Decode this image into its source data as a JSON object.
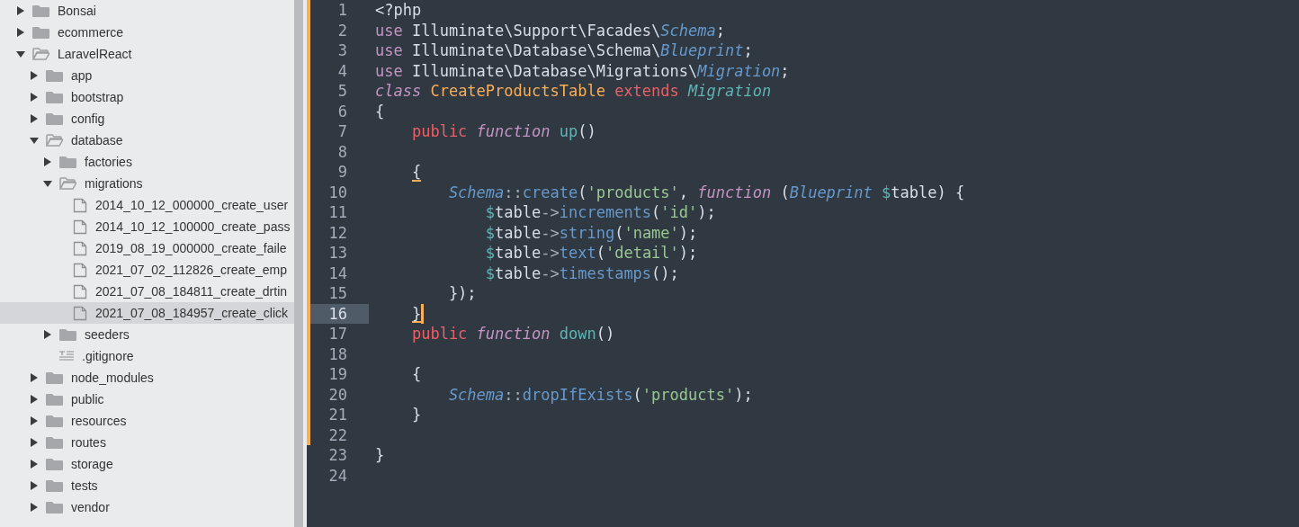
{
  "sidebar": {
    "items": [
      {
        "name": "Bonsai",
        "kind": "folder",
        "expanded": false,
        "selected": false
      },
      {
        "name": "ecommerce",
        "kind": "folder",
        "expanded": false,
        "selected": false
      },
      {
        "name": "LaravelReact",
        "kind": "folder",
        "expanded": true,
        "selected": false,
        "children": [
          {
            "name": "app",
            "kind": "folder",
            "expanded": false,
            "selected": false
          },
          {
            "name": "bootstrap",
            "kind": "folder",
            "expanded": false,
            "selected": false
          },
          {
            "name": "config",
            "kind": "folder",
            "expanded": false,
            "selected": false
          },
          {
            "name": "database",
            "kind": "folder",
            "expanded": true,
            "selected": false,
            "children": [
              {
                "name": "factories",
                "kind": "folder",
                "expanded": false,
                "selected": false
              },
              {
                "name": "migrations",
                "kind": "folder",
                "expanded": true,
                "selected": false,
                "children": [
                  {
                    "name": "2014_10_12_000000_create_user",
                    "kind": "file",
                    "selected": false
                  },
                  {
                    "name": "2014_10_12_100000_create_pass",
                    "kind": "file",
                    "selected": false
                  },
                  {
                    "name": "2019_08_19_000000_create_faile",
                    "kind": "file",
                    "selected": false
                  },
                  {
                    "name": "2021_07_02_112826_create_emp",
                    "kind": "file",
                    "selected": false
                  },
                  {
                    "name": "2021_07_08_184811_create_drtin",
                    "kind": "file",
                    "selected": false
                  },
                  {
                    "name": "2021_07_08_184957_create_click",
                    "kind": "file",
                    "selected": true
                  }
                ]
              },
              {
                "name": "seeders",
                "kind": "folder",
                "expanded": false,
                "selected": false
              },
              {
                "name": ".gitignore",
                "kind": "text",
                "selected": false
              }
            ]
          },
          {
            "name": "node_modules",
            "kind": "folder",
            "expanded": false,
            "selected": false
          },
          {
            "name": "public",
            "kind": "folder",
            "expanded": false,
            "selected": false
          },
          {
            "name": "resources",
            "kind": "folder",
            "expanded": false,
            "selected": false
          },
          {
            "name": "routes",
            "kind": "folder",
            "expanded": false,
            "selected": false
          },
          {
            "name": "storage",
            "kind": "folder",
            "expanded": false,
            "selected": false
          },
          {
            "name": "tests",
            "kind": "folder",
            "expanded": false,
            "selected": false
          },
          {
            "name": "vendor",
            "kind": "folder",
            "expanded": false,
            "selected": false
          }
        ]
      }
    ]
  },
  "editor": {
    "lines": [
      {
        "number": "1",
        "changed": true,
        "current": false,
        "tokens": [
          {
            "text": "<?php",
            "kind": "plain"
          }
        ]
      },
      {
        "number": "2",
        "changed": true,
        "current": false,
        "tokens": [
          {
            "text": "use",
            "kind": "keyword"
          },
          {
            "text": " Illuminate\\Support\\Facades\\",
            "kind": "plain"
          },
          {
            "text": "Schema",
            "kind": "support"
          },
          {
            "text": ";",
            "kind": "plain"
          }
        ]
      },
      {
        "number": "3",
        "changed": true,
        "current": false,
        "tokens": [
          {
            "text": "use",
            "kind": "keyword"
          },
          {
            "text": " Illuminate\\Database\\Schema\\",
            "kind": "plain"
          },
          {
            "text": "Blueprint",
            "kind": "support"
          },
          {
            "text": ";",
            "kind": "plain"
          }
        ]
      },
      {
        "number": "4",
        "changed": true,
        "current": false,
        "tokens": [
          {
            "text": "use",
            "kind": "keyword"
          },
          {
            "text": " Illuminate\\Database\\Migrations\\",
            "kind": "plain"
          },
          {
            "text": "Migration",
            "kind": "support"
          },
          {
            "text": ";",
            "kind": "plain"
          }
        ]
      },
      {
        "number": "5",
        "changed": true,
        "current": false,
        "tokens": [
          {
            "text": "class",
            "kind": "storage"
          },
          {
            "text": " CreateProductsTable",
            "kind": "class"
          },
          {
            "text": " extends",
            "kind": "modifier"
          },
          {
            "text": " Migration",
            "kind": "inherit"
          }
        ]
      },
      {
        "number": "6",
        "changed": true,
        "current": false,
        "tokens": [
          {
            "text": "{",
            "kind": "plain"
          }
        ]
      },
      {
        "number": "7",
        "changed": true,
        "current": false,
        "tokens": [
          {
            "text": "    public",
            "kind": "modifier"
          },
          {
            "text": " function",
            "kind": "storage"
          },
          {
            "text": " up",
            "kind": "function"
          },
          {
            "text": "()",
            "kind": "plain"
          }
        ]
      },
      {
        "number": "8",
        "changed": true,
        "current": false
      },
      {
        "number": "9",
        "changed": true,
        "current": false,
        "tokens": [
          {
            "text": "    {",
            "kind": "match"
          }
        ]
      },
      {
        "number": "10",
        "changed": true,
        "current": false,
        "tokens": [
          {
            "text": "        Schema",
            "kind": "support"
          },
          {
            "text": "::",
            "kind": "operator"
          },
          {
            "text": "create",
            "kind": "method"
          },
          {
            "text": "(",
            "kind": "plain"
          },
          {
            "text": "'products'",
            "kind": "string"
          },
          {
            "text": ",",
            "kind": "plain"
          },
          {
            "text": " function",
            "kind": "storage"
          },
          {
            "text": " (",
            "kind": "plain"
          },
          {
            "text": "Blueprint",
            "kind": "support"
          },
          {
            "text": " $",
            "kind": "sigil"
          },
          {
            "text": "table) {",
            "kind": "plain"
          }
        ]
      },
      {
        "number": "11",
        "changed": true,
        "current": false,
        "tokens": [
          {
            "text": "            $",
            "kind": "sigil"
          },
          {
            "text": "table",
            "kind": "plain"
          },
          {
            "text": "->",
            "kind": "operator"
          },
          {
            "text": "increments",
            "kind": "method"
          },
          {
            "text": "(",
            "kind": "plain"
          },
          {
            "text": "'id'",
            "kind": "string"
          },
          {
            "text": ");",
            "kind": "plain"
          }
        ]
      },
      {
        "number": "12",
        "changed": true,
        "current": false,
        "tokens": [
          {
            "text": "            $",
            "kind": "sigil"
          },
          {
            "text": "table",
            "kind": "plain"
          },
          {
            "text": "->",
            "kind": "operator"
          },
          {
            "text": "string",
            "kind": "method"
          },
          {
            "text": "(",
            "kind": "plain"
          },
          {
            "text": "'name'",
            "kind": "string"
          },
          {
            "text": ");",
            "kind": "plain"
          }
        ]
      },
      {
        "number": "13",
        "changed": true,
        "current": false,
        "tokens": [
          {
            "text": "            $",
            "kind": "sigil"
          },
          {
            "text": "table",
            "kind": "plain"
          },
          {
            "text": "->",
            "kind": "operator"
          },
          {
            "text": "text",
            "kind": "method"
          },
          {
            "text": "(",
            "kind": "plain"
          },
          {
            "text": "'detail'",
            "kind": "string"
          },
          {
            "text": ");",
            "kind": "plain"
          }
        ]
      },
      {
        "number": "14",
        "changed": true,
        "current": false,
        "tokens": [
          {
            "text": "            $",
            "kind": "sigil"
          },
          {
            "text": "table",
            "kind": "plain"
          },
          {
            "text": "->",
            "kind": "operator"
          },
          {
            "text": "timestamps",
            "kind": "method"
          },
          {
            "text": "();",
            "kind": "plain"
          }
        ]
      },
      {
        "number": "15",
        "changed": true,
        "current": false,
        "tokens": [
          {
            "text": "        });",
            "kind": "plain"
          }
        ]
      },
      {
        "number": "16",
        "changed": true,
        "current": true,
        "tokens": [
          {
            "text": "    }",
            "kind": "match"
          }
        ]
      },
      {
        "number": "17",
        "changed": true,
        "current": false,
        "tokens": [
          {
            "text": "    public",
            "kind": "modifier"
          },
          {
            "text": " function",
            "kind": "storage"
          },
          {
            "text": " down",
            "kind": "function"
          },
          {
            "text": "()",
            "kind": "plain"
          }
        ]
      },
      {
        "number": "18",
        "changed": true,
        "current": false
      },
      {
        "number": "19",
        "changed": true,
        "current": false,
        "tokens": [
          {
            "text": "    {",
            "kind": "plain"
          }
        ]
      },
      {
        "number": "20",
        "changed": true,
        "current": false,
        "tokens": [
          {
            "text": "        Schema",
            "kind": "support"
          },
          {
            "text": "::",
            "kind": "operator"
          },
          {
            "text": "dropIfExists",
            "kind": "method"
          },
          {
            "text": "(",
            "kind": "plain"
          },
          {
            "text": "'products'",
            "kind": "string"
          },
          {
            "text": ");",
            "kind": "plain"
          }
        ]
      },
      {
        "number": "21",
        "changed": true,
        "current": false,
        "tokens": [
          {
            "text": "    }",
            "kind": "plain"
          }
        ]
      },
      {
        "number": "22",
        "changed": true,
        "current": false
      },
      {
        "number": "23",
        "changed": false,
        "current": false,
        "tokens": [
          {
            "text": "}",
            "kind": "plain"
          }
        ]
      },
      {
        "number": "24",
        "changed": false,
        "current": false
      }
    ]
  }
}
